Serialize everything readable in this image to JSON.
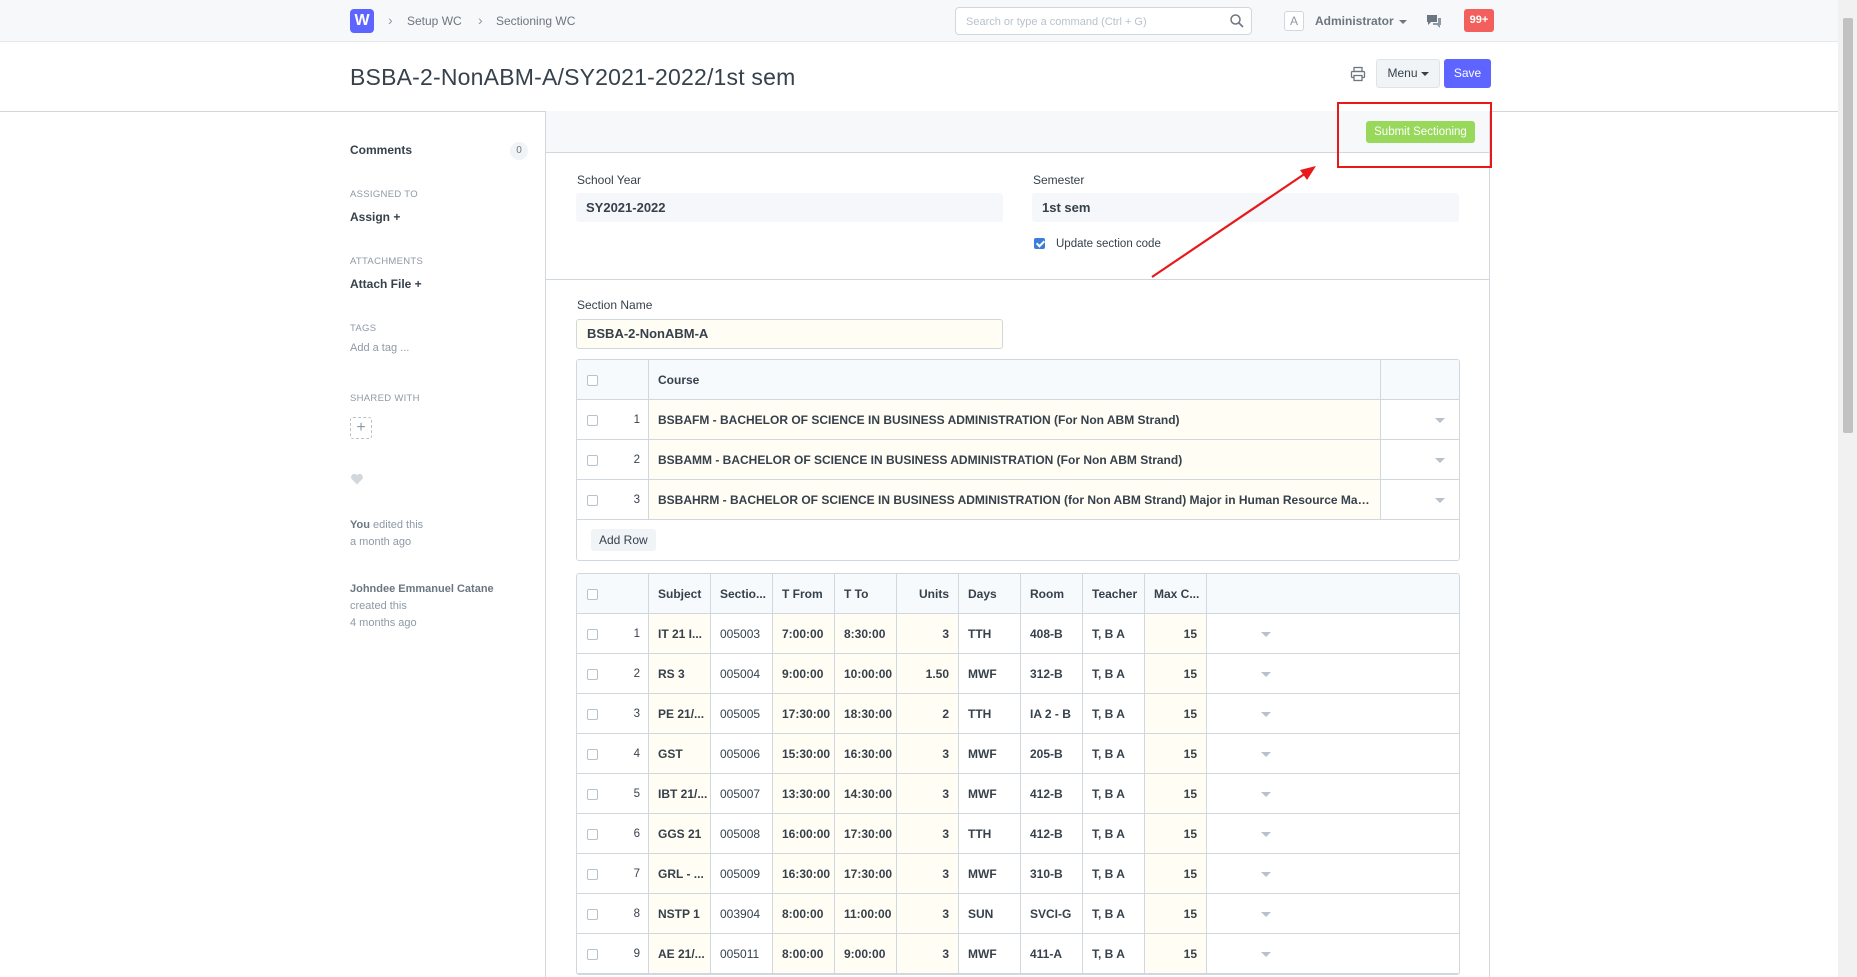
{
  "navbar": {
    "logo": "W",
    "breadcrumbs": [
      "Setup WC",
      "Sectioning WC"
    ],
    "search_placeholder": "Search or type a command (Ctrl + G)",
    "avatar_initial": "A",
    "user": "Administrator",
    "notifications": "99+"
  },
  "page": {
    "title": "BSBA-2-NonABM-A/SY2021-2022/1st sem",
    "menu_label": "Menu",
    "save_label": "Save",
    "submit_label": "Submit Sectioning"
  },
  "sidebar": {
    "comments_label": "Comments",
    "comments_count": "0",
    "assigned_to_label": "ASSIGNED TO",
    "assign_label": "Assign +",
    "attachments_label": "ATTACHMENTS",
    "attach_label": "Attach File +",
    "tags_label": "TAGS",
    "add_tag": "Add a tag ...",
    "shared_with_label": "SHARED WITH",
    "shared_add": "+",
    "timeline": [
      {
        "who": "You",
        "action": " edited this",
        "when": "a month ago"
      },
      {
        "who": "Johndee Emmanuel Catane",
        "action": "created this",
        "when": "4 months ago"
      }
    ]
  },
  "form": {
    "school_year_label": "School Year",
    "school_year": "SY2021-2022",
    "semester_label": "Semester",
    "semester": "1st sem",
    "update_code_label": "Update section code",
    "update_code_checked": true,
    "section_name_label": "Section Name",
    "section_name": "BSBA-2-NonABM-A"
  },
  "courses": {
    "header": "Course",
    "rows": [
      {
        "idx": "1",
        "course": "BSBAFM - BACHELOR OF SCIENCE IN BUSINESS ADMINISTRATION (For Non ABM Strand)"
      },
      {
        "idx": "2",
        "course": "BSBAMM - BACHELOR OF SCIENCE IN BUSINESS ADMINISTRATION (For Non ABM Strand)"
      },
      {
        "idx": "3",
        "course": "BSBAHRM - BACHELOR OF SCIENCE IN BUSINESS ADMINISTRATION (for Non ABM Strand) Major in Human Resource Mana..."
      }
    ],
    "add_row": "Add Row"
  },
  "subjects": {
    "headers": [
      "Subject",
      "Sectio...",
      "T From",
      "T To",
      "Units",
      "Days",
      "Room",
      "Teacher",
      "Max C..."
    ],
    "rows": [
      {
        "idx": "1",
        "subject": "IT 21 I...",
        "section": "005003",
        "t_from": "7:00:00",
        "t_to": "8:30:00",
        "units": "3",
        "days": "TTH",
        "room": "408-B",
        "teacher": "T, B A",
        "max": "15"
      },
      {
        "idx": "2",
        "subject": "RS 3",
        "section": "005004",
        "t_from": "9:00:00",
        "t_to": "10:00:00",
        "units": "1.50",
        "days": "MWF",
        "room": "312-B",
        "teacher": "T, B A",
        "max": "15"
      },
      {
        "idx": "3",
        "subject": "PE 21/...",
        "section": "005005",
        "t_from": "17:30:00",
        "t_to": "18:30:00",
        "units": "2",
        "days": "TTH",
        "room": "IA 2 - B",
        "teacher": "T, B A",
        "max": "15"
      },
      {
        "idx": "4",
        "subject": "GST",
        "section": "005006",
        "t_from": "15:30:00",
        "t_to": "16:30:00",
        "units": "3",
        "days": "MWF",
        "room": "205-B",
        "teacher": "T, B A",
        "max": "15"
      },
      {
        "idx": "5",
        "subject": "IBT 21/...",
        "section": "005007",
        "t_from": "13:30:00",
        "t_to": "14:30:00",
        "units": "3",
        "days": "MWF",
        "room": "412-B",
        "teacher": "T, B A",
        "max": "15"
      },
      {
        "idx": "6",
        "subject": "GGS 21",
        "section": "005008",
        "t_from": "16:00:00",
        "t_to": "17:30:00",
        "units": "3",
        "days": "TTH",
        "room": "412-B",
        "teacher": "T, B A",
        "max": "15"
      },
      {
        "idx": "7",
        "subject": "GRL - ...",
        "section": "005009",
        "t_from": "16:30:00",
        "t_to": "17:30:00",
        "units": "3",
        "days": "MWF",
        "room": "310-B",
        "teacher": "T, B A",
        "max": "15"
      },
      {
        "idx": "8",
        "subject": "NSTP 1",
        "section": "003904",
        "t_from": "8:00:00",
        "t_to": "11:00:00",
        "units": "3",
        "days": "SUN",
        "room": "SVCI-G",
        "teacher": "T, B A",
        "max": "15"
      },
      {
        "idx": "9",
        "subject": "AE 21/...",
        "section": "005011",
        "t_from": "8:00:00",
        "t_to": "9:00:00",
        "units": "3",
        "days": "MWF",
        "room": "411-A",
        "teacher": "T, B A",
        "max": "15"
      }
    ]
  },
  "colors": {
    "primary": "#5e64ff",
    "submit": "#98d85b",
    "annotation": "#e8191a",
    "badge": "#f25f5c"
  }
}
